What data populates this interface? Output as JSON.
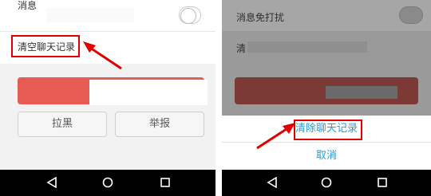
{
  "left_screen": {
    "mute_label": "消息",
    "clear_history_label": "清空聊天记录",
    "report_buttons": {
      "block": "拉黑",
      "report": "举报"
    }
  },
  "right_screen": {
    "mute_label": "消息免打扰",
    "clear_history_label": "清",
    "action_sheet": {
      "clear_action": "清除聊天记录",
      "cancel": "取消"
    }
  },
  "colors": {
    "danger_button": "#e65c54",
    "sheet_action_text": "#2a9bd8",
    "highlight_frame": "#e00000"
  },
  "icons": [
    "back-triangle-icon",
    "home-circle-icon",
    "recent-apps-square-icon"
  ]
}
